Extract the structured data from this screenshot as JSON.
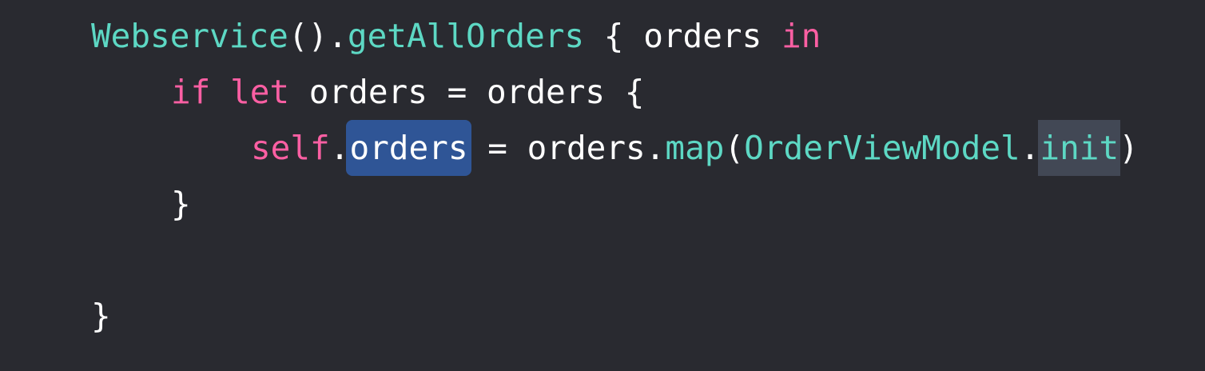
{
  "colors": {
    "background": "#292a30",
    "keyword": "#fc5fa3",
    "type": "#5dd8c4",
    "plain": "#ffffff",
    "selection": "#2f5596",
    "highlight": "#424855"
  },
  "code": {
    "line1": {
      "type": "Webservice",
      "call_parens": "().",
      "method": "getAllOrders",
      "brace_open": " { ",
      "param": "orders",
      "space": " ",
      "kw_in": "in"
    },
    "line2": {
      "kw_if": "if",
      "space1": " ",
      "kw_let": "let",
      "rest": " orders = orders {"
    },
    "line3": {
      "kw_self": "self",
      "dot": ".",
      "selected": "orders",
      "mid": " = orders.",
      "method": "map",
      "paren_open": "(",
      "type": "OrderViewModel",
      "dot2": ".",
      "highlighted": "init",
      "paren_close": ")"
    },
    "line4": {
      "brace_close": "}"
    },
    "line6": {
      "brace_close": "}"
    }
  }
}
